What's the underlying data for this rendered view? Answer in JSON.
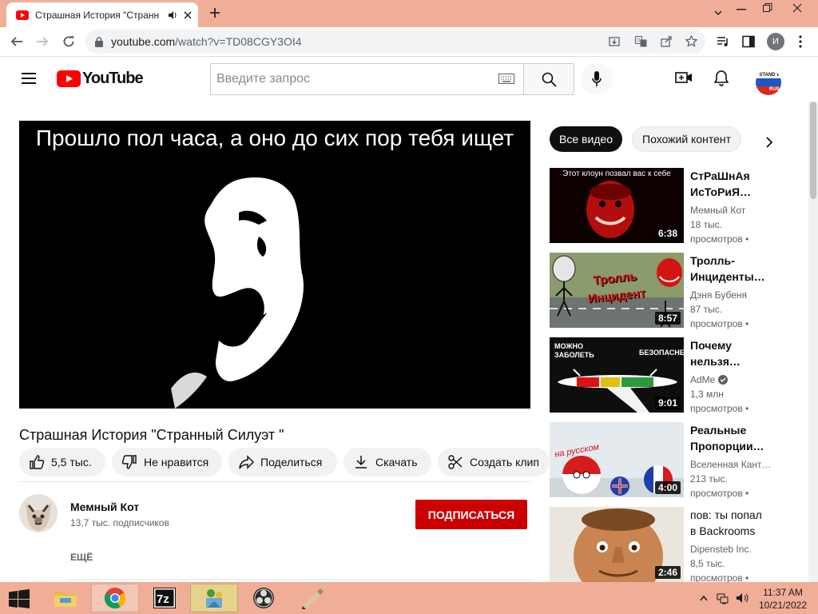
{
  "browser": {
    "tab_title": "Страшная История \"Странн",
    "url_host": "youtube.com",
    "url_path": "/watch?v=TD08CGY3OI4",
    "profile_initial": "И"
  },
  "youtube": {
    "logo_text": "YouTube",
    "search_placeholder": "Введите запрос",
    "avatar_text_top": "I STAND W",
    "avatar_text_bottom": "RUS"
  },
  "video": {
    "caption": "Прошло пол часа, а оно до сих пор тебя ищет",
    "title": "Страшная История \"Странный Силуэт \"",
    "likes": "5,5 тыс.",
    "dislike_label": "Не нравится",
    "share_label": "Поделиться",
    "download_label": "Скачать",
    "clip_label": "Создать клип",
    "channel_name": "Мемный Кот",
    "subscribers": "13,7 тыс. подписчиков",
    "subscribe_label": "ПОДПИСАТЬСЯ",
    "more_label": "ЕЩЁ"
  },
  "chips": [
    "Все видео",
    "Похожий контент"
  ],
  "recommendations": [
    {
      "title_line1": "СтРаШнАя",
      "title_line2": "ИсТоРиЯ…",
      "channel": "Мемный Кот",
      "views": "18 тыс.",
      "age": "просмотров •",
      "duration": "6:38",
      "thumb_text": "Этот клоун позвал вас к себе",
      "verified": false
    },
    {
      "title_line1": "Тролль-",
      "title_line2": "Инциденты…",
      "channel": "Дэня Бубеня",
      "views": "87 тыс.",
      "age": "просмотров •",
      "duration": "8:57",
      "thumb_text": "Тролль Инцидент",
      "verified": false
    },
    {
      "title_line1": "Почему",
      "title_line2": "нельзя…",
      "channel": "AdMe",
      "views": "1,3 млн",
      "age": "просмотров •",
      "duration": "9:01",
      "thumb_text_a": "МОЖНО ЗАБОЛЕТЬ",
      "thumb_text_b": "БЕЗОПАСНЕЕ",
      "verified": true
    },
    {
      "title_line1": "Реальные",
      "title_line2": "Пропорции…",
      "channel": "Вселенная Кант…",
      "views": "213 тыс.",
      "age": "просмотров •",
      "duration": "4:00",
      "thumb_text": "на русском",
      "verified": false
    },
    {
      "title_line1": "пов: ты попал",
      "title_line2": "в Backrooms",
      "channel": "Dipensteb Inc.",
      "views": "8,5 тыс.",
      "age": "просмотров •",
      "duration": "2:46",
      "verified": false
    }
  ],
  "taskbar": {
    "time": "11:37 AM",
    "date": "10/21/2022",
    "apps": [
      "file-explorer",
      "chrome",
      "7-zip",
      "network-app",
      "obs",
      "paint-app"
    ]
  },
  "colors": {
    "accent": "#cc0000",
    "titlebar": "#f0ae98",
    "taskbar": "#f0ae98"
  }
}
